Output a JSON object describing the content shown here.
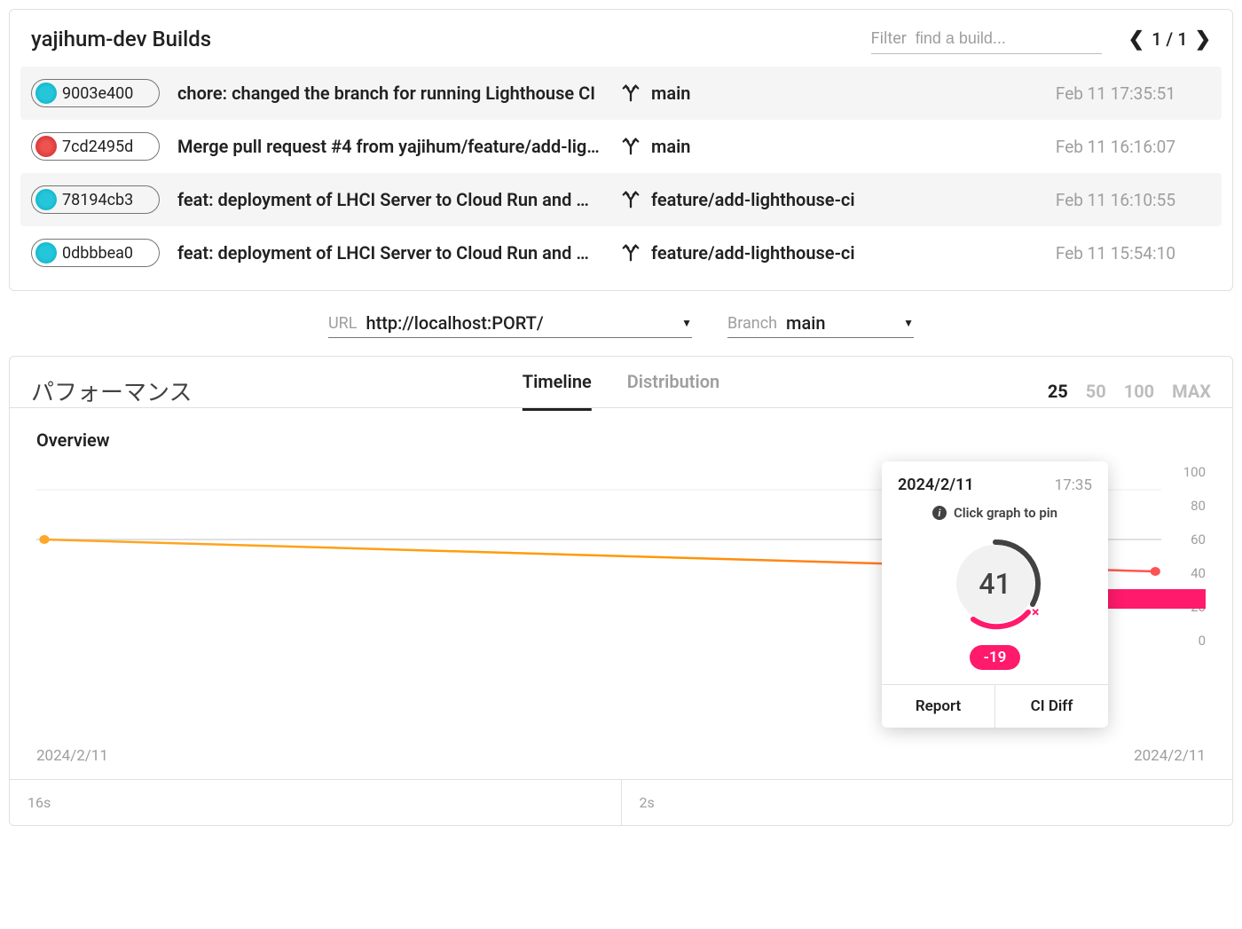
{
  "header": {
    "title": "yajihum-dev Builds",
    "filter_label": "Filter",
    "filter_placeholder": "find a build...",
    "pager": "1 / 1"
  },
  "builds": [
    {
      "hash": "9003e400",
      "icon_color": "teal",
      "message": "chore: changed the branch for running Lighthouse CI",
      "branch": "main",
      "time": "Feb 11 17:35:51"
    },
    {
      "hash": "7cd2495d",
      "icon_color": "red",
      "message": "Merge pull request #4 from yajihum/feature/add-lig…",
      "branch": "main",
      "time": "Feb 11 16:16:07"
    },
    {
      "hash": "78194cb3",
      "icon_color": "teal",
      "message": "feat: deployment of LHCI Server to Cloud Run and …",
      "branch": "feature/add-lighthouse-ci",
      "time": "Feb 11 16:10:55"
    },
    {
      "hash": "0dbbbea0",
      "icon_color": "teal",
      "message": "feat: deployment of LHCI Server to Cloud Run and …",
      "branch": "feature/add-lighthouse-ci",
      "time": "Feb 11 15:54:10"
    }
  ],
  "selectors": {
    "url_label": "URL",
    "url_value": "http://localhost:PORT/",
    "branch_label": "Branch",
    "branch_value": "main"
  },
  "perf": {
    "title": "パフォーマンス",
    "tabs": {
      "timeline": "Timeline",
      "distribution": "Distribution"
    },
    "ranges": [
      "25",
      "50",
      "100",
      "MAX"
    ],
    "active_range": "25",
    "overview_title": "Overview",
    "x_left": "2024/2/11",
    "x_right": "2024/2/11",
    "y_ticks": [
      "100",
      "80",
      "60",
      "40",
      "20",
      "0"
    ]
  },
  "tooltip": {
    "date": "2024/2/11",
    "time": "17:35",
    "hint": "Click graph to pin",
    "score": "41",
    "delta": "-19",
    "report_btn": "Report",
    "diff_btn": "CI Diff"
  },
  "metrics": {
    "left": "16s",
    "right": "2s"
  },
  "chart_data": {
    "type": "line",
    "x": [
      "2024/2/11",
      "2024/2/11"
    ],
    "series": [
      {
        "name": "Performance",
        "values": [
          60,
          41
        ]
      }
    ],
    "ylim": [
      0,
      100
    ],
    "ylabel": "",
    "xlabel": ""
  }
}
